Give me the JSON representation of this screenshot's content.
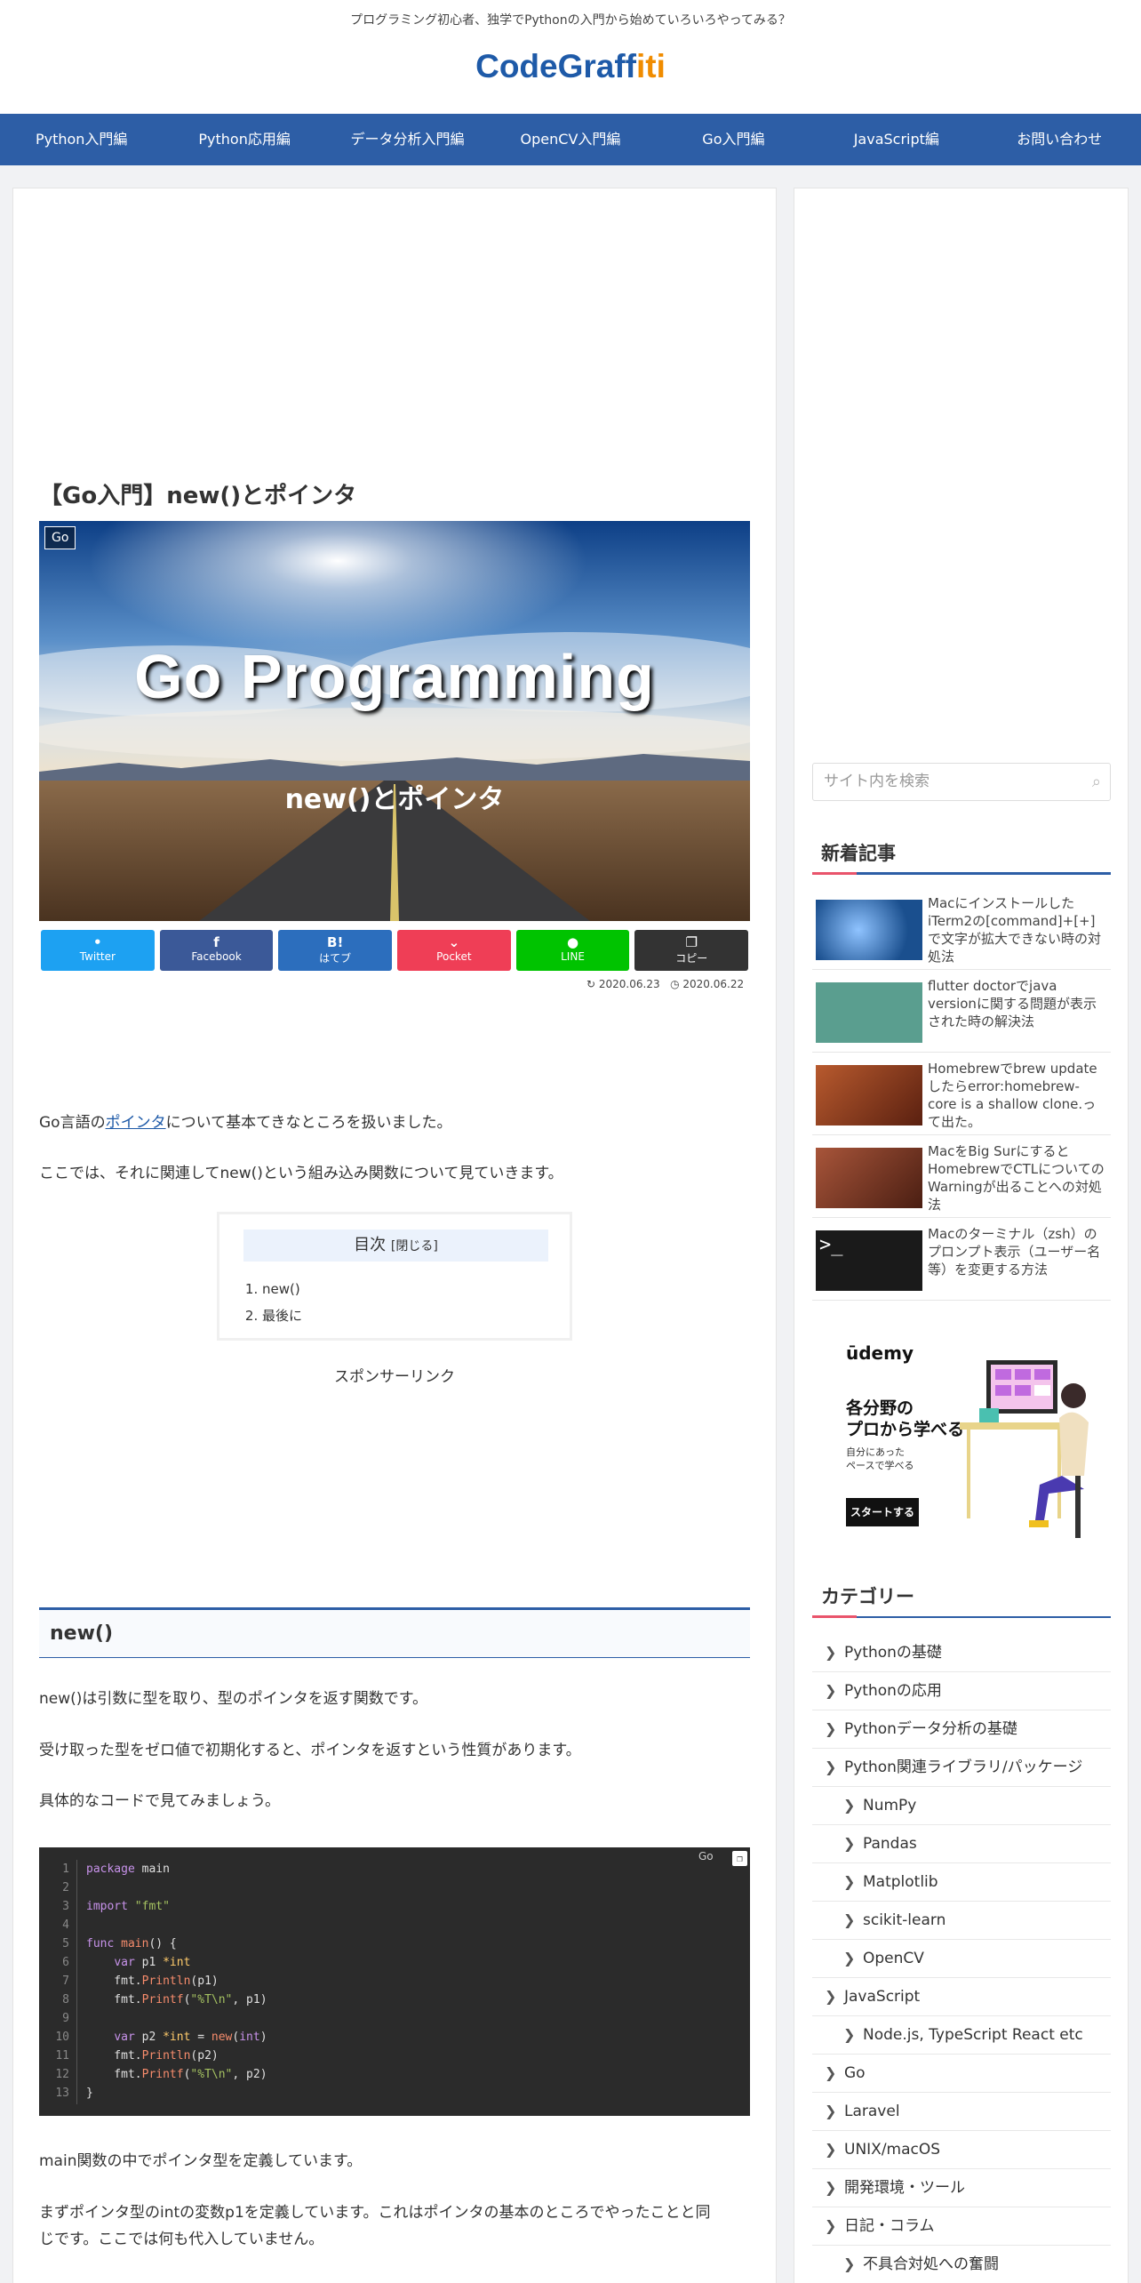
{
  "header": {
    "tagline": "プログラミング初心者、独学でPythonの入門から始めていろいろやってみる？",
    "logo_part1": "CodeGraff",
    "logo_part2": "iti"
  },
  "nav": [
    "Python入門編",
    "Python応用編",
    "データ分析入門編",
    "OpenCV入門編",
    "Go入門編",
    "JavaScript編",
    "お問い合わせ"
  ],
  "article": {
    "title": "【Go入門】new()とポインタ",
    "category": "Go",
    "eyecatch_title": "Go Programming",
    "eyecatch_subtitle": "new()とポインタ",
    "share": [
      {
        "label": "Twitter",
        "icon": "twitter-icon",
        "color": "#1da1f2"
      },
      {
        "label": "Facebook",
        "icon": "facebook-icon",
        "color": "#3b5998"
      },
      {
        "label": "はてブ",
        "icon": "hatena-icon",
        "color": "#2c6ebd"
      },
      {
        "label": "Pocket",
        "icon": "pocket-icon",
        "color": "#ef3e56"
      },
      {
        "label": "LINE",
        "icon": "line-icon",
        "color": "#00c300"
      },
      {
        "label": "コピー",
        "icon": "copy-icon",
        "color": "#333333"
      }
    ],
    "published": "2020.06.23",
    "updated": "2020.06.22",
    "intro_pre": "Go言語の",
    "intro_link": "ポインタ",
    "intro_post": "について基本てきなところを扱いました。",
    "intro2": "ここでは、それに関連してnew()という組み込み関数について見ていきます。",
    "toc": {
      "title": "目次",
      "toggle": "[閉じる]",
      "items": [
        "new()",
        "最後に"
      ]
    },
    "sponsor": "スポンサーリンク",
    "h2": "new()",
    "p1": "new()は引数に型を取り、型のポインタを返す関数です。",
    "p2": "受け取った型をゼロ値で初期化すると、ポインタを返すという性質があります。",
    "p3": "具体的なコードで見てみましょう。",
    "code_lang": "Go",
    "p4": "main関数の中でポインタ型を定義しています。",
    "p5a": "まずポインタ型のintの変数p1を定義しています。これはポインタの基本のところでやったことと同",
    "p5b": "じです。ここでは何も代入していません。"
  },
  "sidebar": {
    "search_placeholder": "サイト内を検索",
    "new_heading": "新着記事",
    "new_posts": [
      {
        "title": "MacにインストールしたiTerm2の[command]+[+]で文字が拡大できない時の対処法",
        "thumb_color": "#1a4f8e"
      },
      {
        "title": "flutter doctorでjava versionに関する問題が表示された時の解決法",
        "thumb_color": "#5a9e8f"
      },
      {
        "title": "Homebrewでbrew updateしたらerror:homebrew-core is a shallow clone.って出た。",
        "thumb_color": "#8a3a22"
      },
      {
        "title": "MacをBig SurにするとHomebrewでCTLについてのWarningが出ることへの対処法",
        "thumb_color": "#7a3a28"
      },
      {
        "title": "Macのターミナル（zsh）のプロンプト表示（ユーザー名等）を変更する方法",
        "thumb_color": "#1a1a1a"
      }
    ],
    "ad": {
      "brand": "ūdemy",
      "line1": "各分野の",
      "line2": "プロから学べる",
      "line3": "自分にあった",
      "line4": "ペースで学べる",
      "cta": "スタートする"
    },
    "cat_heading": "カテゴリー",
    "categories": [
      {
        "label": "Pythonの基礎",
        "child": false
      },
      {
        "label": "Pythonの応用",
        "child": false
      },
      {
        "label": "Pythonデータ分析の基礎",
        "child": false
      },
      {
        "label": "Python関連ライブラリ/パッケージ",
        "child": false
      },
      {
        "label": "NumPy",
        "child": true
      },
      {
        "label": "Pandas",
        "child": true
      },
      {
        "label": "Matplotlib",
        "child": true
      },
      {
        "label": "scikit-learn",
        "child": true
      },
      {
        "label": "OpenCV",
        "child": true
      },
      {
        "label": "JavaScript",
        "child": false
      },
      {
        "label": "Node.js, TypeScript React etc",
        "child": true
      },
      {
        "label": "Go",
        "child": false
      },
      {
        "label": "Laravel",
        "child": false
      },
      {
        "label": "UNIX/macOS",
        "child": false
      },
      {
        "label": "開発環境・ツール",
        "child": false
      },
      {
        "label": "日記・コラム",
        "child": false
      },
      {
        "label": "不具合対処への奮闘",
        "child": true
      }
    ]
  }
}
